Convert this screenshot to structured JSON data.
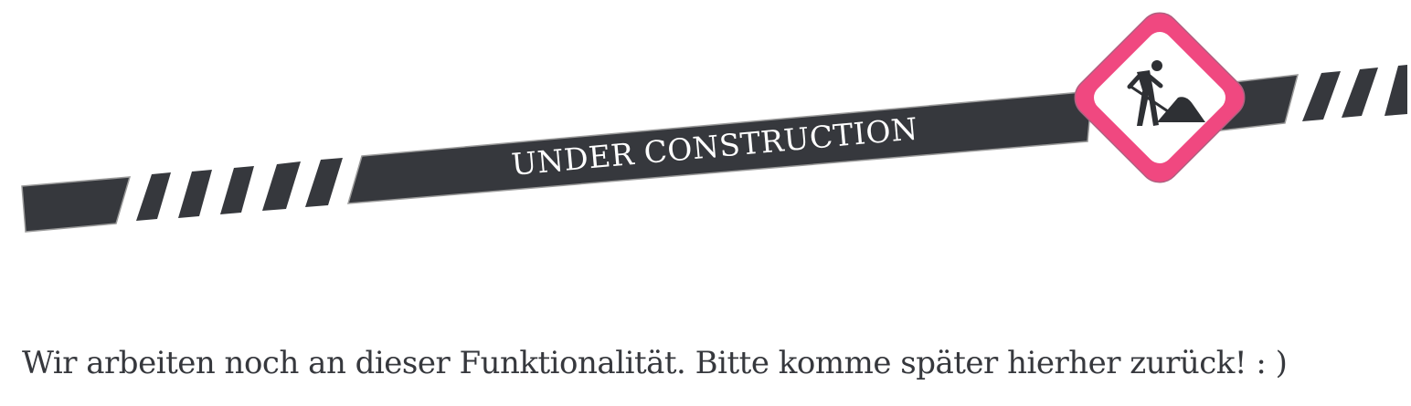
{
  "banner": {
    "label": "UNDER CONSTRUCTION",
    "sign_icon": "worker-shoveling-icon",
    "colors": {
      "tape": "#36383d",
      "tape_outline": "#9a9a9a",
      "sign_border": "#f04880",
      "sign_fill": "#ffffff",
      "icon": "#2e3034"
    }
  },
  "message": {
    "text": "Wir arbeiten noch an dieser Funktionalität. Bitte komme später hierher zurück! : )"
  }
}
